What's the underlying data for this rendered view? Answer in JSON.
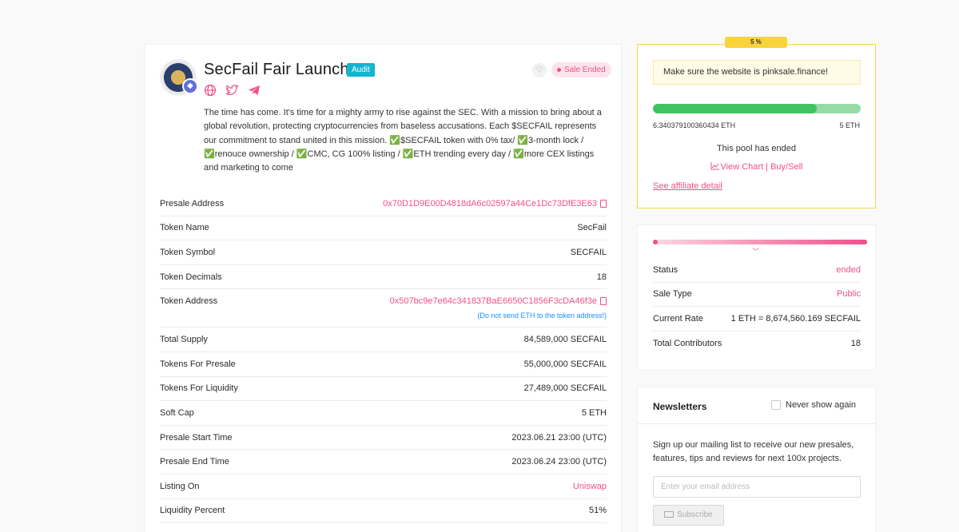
{
  "project": {
    "title": "SecFail Fair Launch",
    "audit_label": "Audit",
    "status_badge": "Sale Ended",
    "description": "The time has come. It's time for a mighty army to rise against the SEC. With a mission to bring about a global revolution, protecting cryptocurrencies from baseless accusations. Each $SECFAIL represents our commitment to stand united in this mission. ✅$SECFAIL token with 0% tax/ ✅3-month lock / ✅renouce ownership / ✅CMC, CG 100% listing / ✅ETH trending every day / ✅more CEX listings and marketing to come",
    "social_icons": [
      "globe-icon",
      "twitter-icon",
      "telegram-icon"
    ]
  },
  "details": {
    "presale_address_label": "Presale Address",
    "presale_address": "0x70D1D9E00D4818dA6c02597a44Ce1Dc73DfE3E63",
    "token_name_label": "Token Name",
    "token_name": "SecFail",
    "token_symbol_label": "Token Symbol",
    "token_symbol": "SECFAIL",
    "token_decimals_label": "Token Decimals",
    "token_decimals": "18",
    "token_address_label": "Token Address",
    "token_address": "0x507bc9e7e64c341837BaE6650C1856F3cDA46f3e",
    "token_address_note": "(Do not send ETH to the token address!)",
    "total_supply_label": "Total Supply",
    "total_supply": "84,589,000 SECFAIL",
    "tokens_presale_label": "Tokens For Presale",
    "tokens_presale": "55,000,000 SECFAIL",
    "tokens_liquidity_label": "Tokens For Liquidity",
    "tokens_liquidity": "27,489,000 SECFAIL",
    "soft_cap_label": "Soft Cap",
    "soft_cap": "5 ETH",
    "start_label": "Presale Start Time",
    "start": "2023.06.21 23:00 (UTC)",
    "end_label": "Presale End Time",
    "end": "2023.06.24 23:00 (UTC)",
    "listing_label": "Listing On",
    "listing": "Uniswap",
    "liquidity_label": "Liquidity Percent",
    "liquidity": "51%"
  },
  "pool": {
    "percent_tag": "5 %",
    "warning": "Make sure the website is pinksale.finance!",
    "progress_fraction": 0.79,
    "raised": "6.340379100360434 ETH",
    "cap": "5 ETH",
    "ended_text": "This pool has ended",
    "chart_link": "View Chart | Buy/Sell",
    "affiliate": "See affiliate detail"
  },
  "status": {
    "status_label": "Status",
    "status_value": "ended",
    "sale_type_label": "Sale Type",
    "sale_type_value": "Public",
    "rate_label": "Current Rate",
    "rate_value": "1 ETH = 8,674,560.169 SECFAIL",
    "contributors_label": "Total Contributors",
    "contributors_value": "18"
  },
  "newsletter": {
    "title": "Newsletters",
    "never_show": "Never show again",
    "text": "Sign up our mailing list to receive our new presales, features, tips and reviews for next 100x projects.",
    "email_placeholder": "Enter your email address",
    "subscribe_label": "Subscribe"
  },
  "colors": {
    "accent": "#f0508a",
    "progress": "#40c463",
    "warning_border": "#f6d64a",
    "audit": "#11b5d0"
  }
}
